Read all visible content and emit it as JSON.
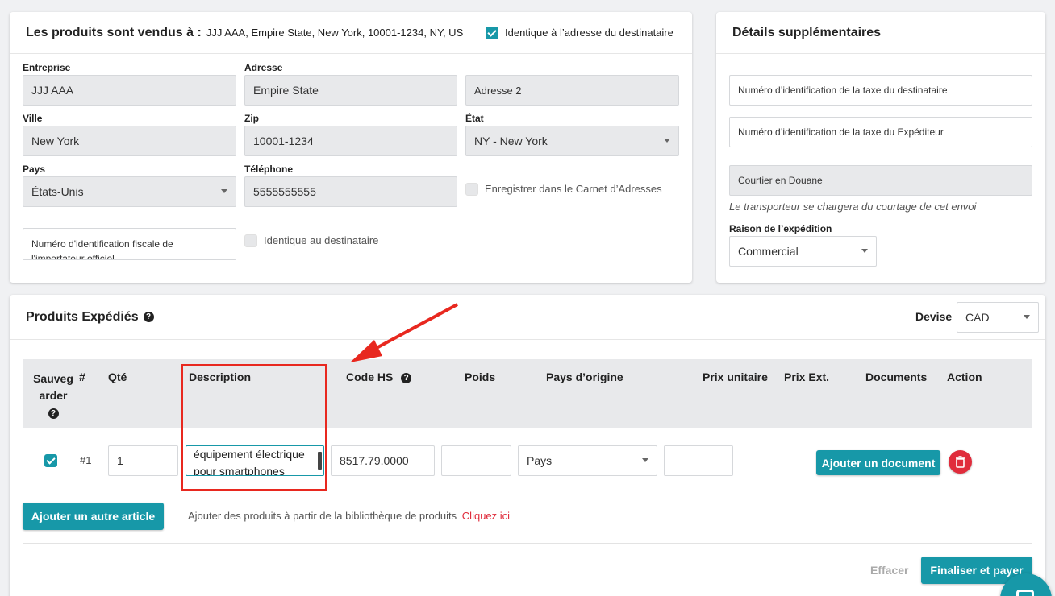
{
  "seller": {
    "title": "Les produits sont vendus à :",
    "address_summary": "JJJ AAA, Empire State, New York, 10001-1234, NY, US",
    "same_as_recipient_label": "Identique à l’adresse du destinataire",
    "same_as_recipient_checked": true,
    "company_label": "Entreprise",
    "company_value": "JJJ AAA",
    "address_label": "Adresse",
    "address_value": "Empire State",
    "address2_placeholder": "Adresse 2",
    "city_label": "Ville",
    "city_value": "New York",
    "zip_label": "Zip",
    "zip_value": "10001-1234",
    "state_label": "État",
    "state_value": "NY - New York",
    "country_label": "Pays",
    "country_value": "États-Unis",
    "phone_label": "Téléphone",
    "phone_value": "5555555555",
    "save_address_book_label": "Enregistrer dans le Carnet d’Adresses",
    "importer_tax_id_placeholder": "Numéro d'identification fiscale de l'importateur officiel",
    "same_as_recipient2_label": "Identique au destinataire"
  },
  "details": {
    "title": "Détails supplémentaires",
    "recipient_tax_placeholder": "Numéro d’identification de la taxe du destinataire",
    "shipper_tax_placeholder": "Numéro d’identification de la taxe du Expéditeur",
    "customs_broker_placeholder": "Courtier en Douane",
    "broker_note": "Le transporteur se chargera du courtage de cet envoi",
    "reason_label": "Raison de l’expédition",
    "reason_value": "Commercial"
  },
  "products": {
    "title": "Produits Expédiés",
    "currency_label": "Devise",
    "currency_value": "CAD",
    "headers": {
      "save": "Sauvegarder",
      "number": "#",
      "qty": "Qté",
      "description": "Description",
      "hs_code": "Code HS",
      "weight": "Poids",
      "origin": "Pays d’origine",
      "unit_price": "Prix unitaire",
      "ext_price": "Prix Ext.",
      "documents": "Documents",
      "action": "Action"
    },
    "rows": [
      {
        "saved": true,
        "number": "#1",
        "qty": "1",
        "description": "équipement électrique pour smartphones",
        "hs_code": "8517.79.0000",
        "weight": "",
        "origin": "Pays",
        "unit_price": "",
        "add_document_label": "Ajouter un document"
      }
    ],
    "add_item_label": "Ajouter un autre article",
    "library_text": "Ajouter des produits à partir de la bibliothèque de produits",
    "library_link": "Cliquez ici",
    "clear_label": "Effacer",
    "finalize_label": "Finaliser et payer"
  },
  "colors": {
    "accent": "#1798a8",
    "danger": "#e02c3c",
    "highlight": "#e8281f"
  }
}
